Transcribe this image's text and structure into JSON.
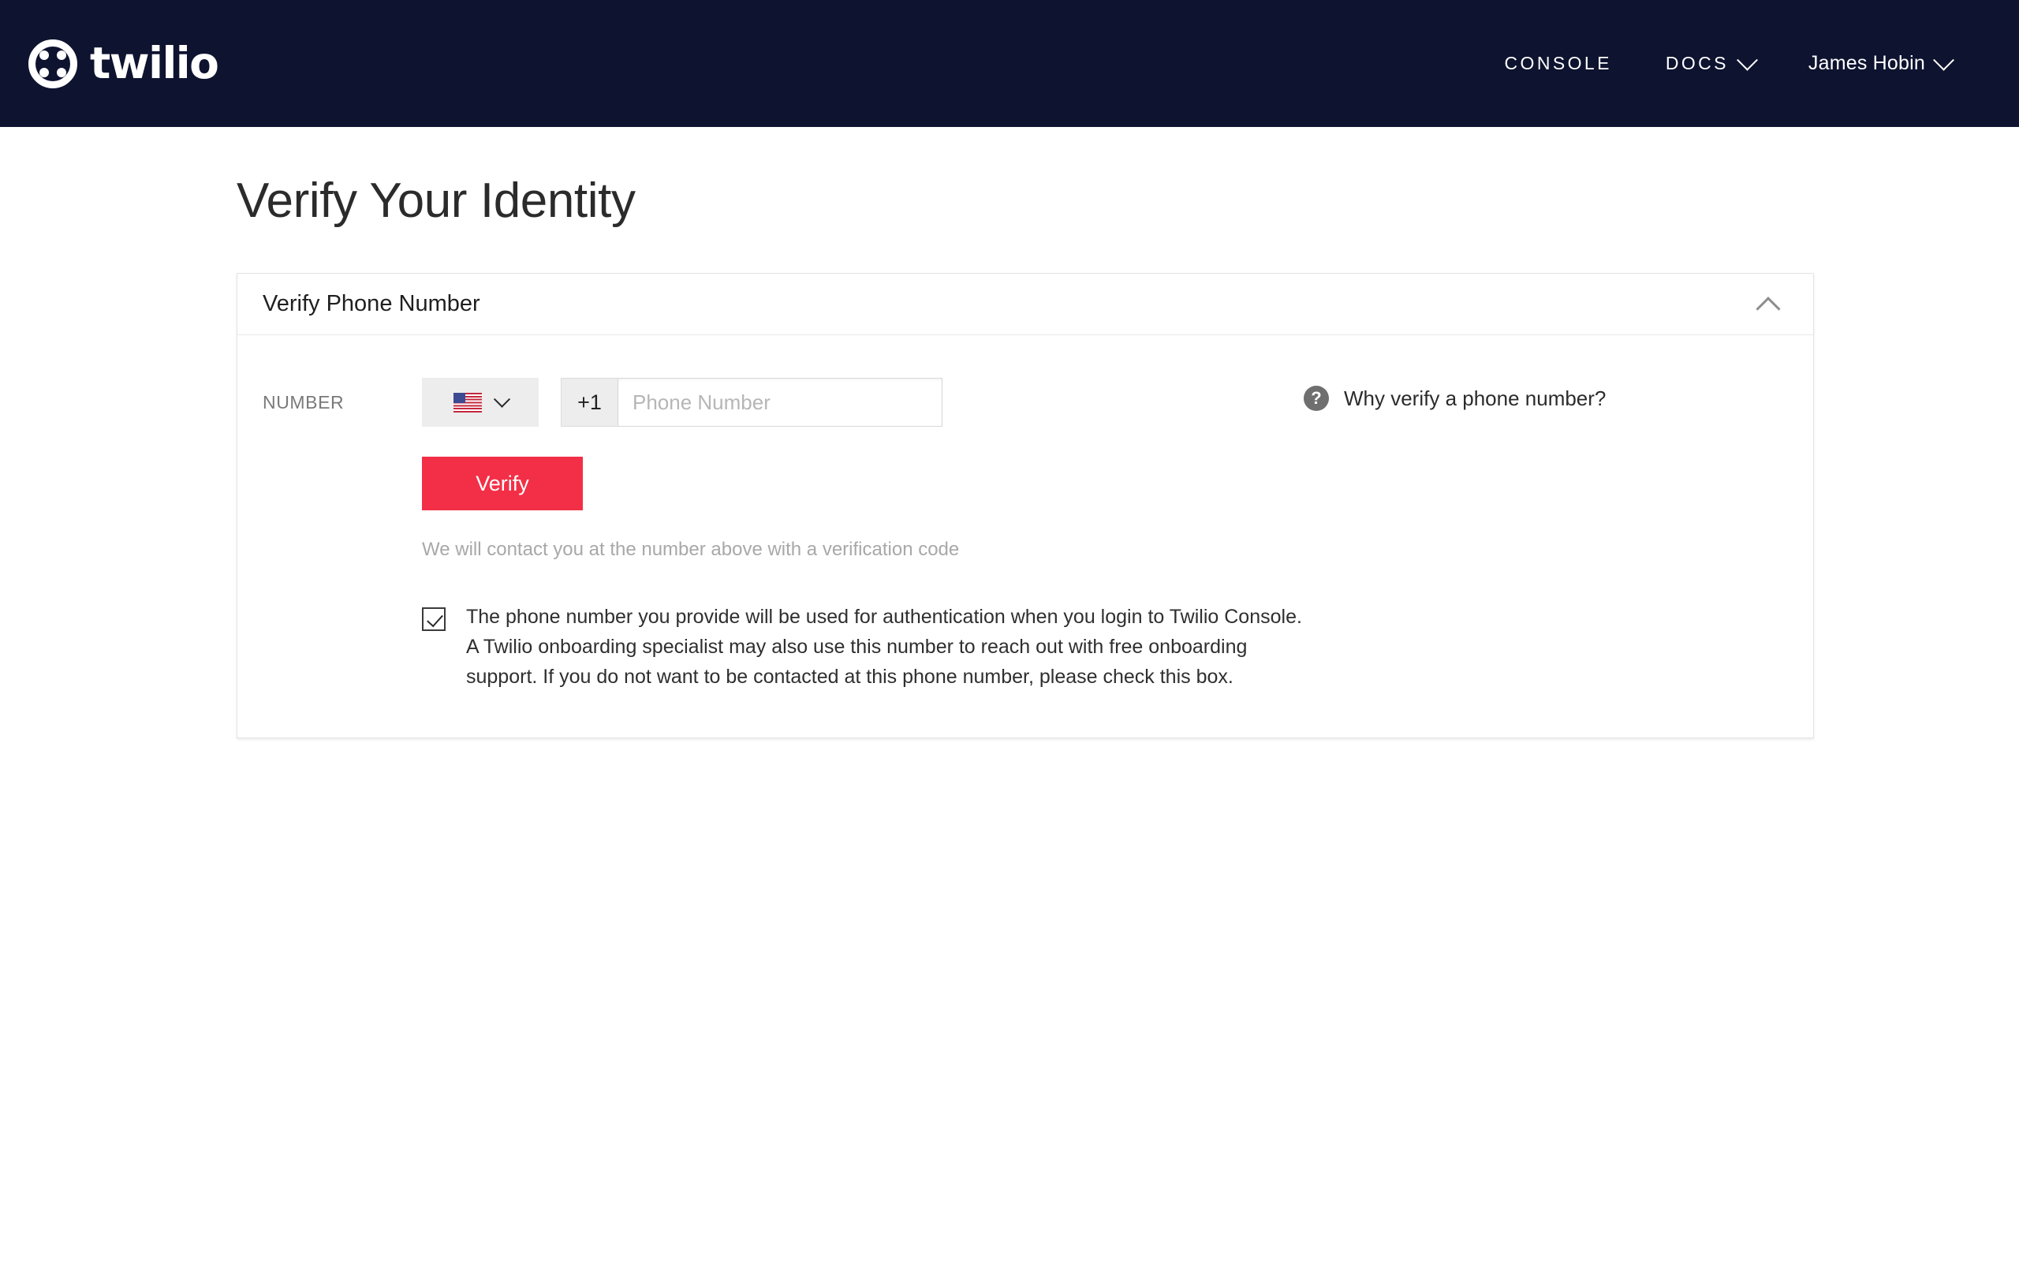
{
  "topbar": {
    "background_color": "#0e1330",
    "logo": {
      "name": "twilio",
      "wordmark": "twilio"
    },
    "nav": [
      {
        "id": "console",
        "label": "CONSOLE",
        "has_chevron": false
      },
      {
        "id": "docs",
        "label": "DOCS",
        "has_chevron": true
      },
      {
        "id": "user",
        "label": "James Hobin",
        "has_chevron": true
      }
    ]
  },
  "page": {
    "title": "Verify Your Identity"
  },
  "card": {
    "header_title": "Verify Phone Number",
    "collapse_icon": "chevron-up-icon",
    "field": {
      "label": "NUMBER",
      "country_flag": "us-flag-icon",
      "country_chevron": "chevron-down-icon",
      "dial_code": "+1",
      "phone_placeholder": "Phone Number",
      "phone_value": ""
    },
    "verify_button": {
      "label": "Verify",
      "color": "#f22f46"
    },
    "helper_text": "We will contact you at the number above with a verification code",
    "consent": {
      "checked": true,
      "text": "The phone number you provide will be used for authentication when you login to Twilio Console. A Twilio onboarding specialist may also use this number to reach out with free onboarding support. If you do not want to be contacted at this phone number, please check this box."
    },
    "why_link": {
      "icon": "help-circle-icon",
      "icon_glyph": "?",
      "label": "Why verify a phone number?"
    }
  }
}
